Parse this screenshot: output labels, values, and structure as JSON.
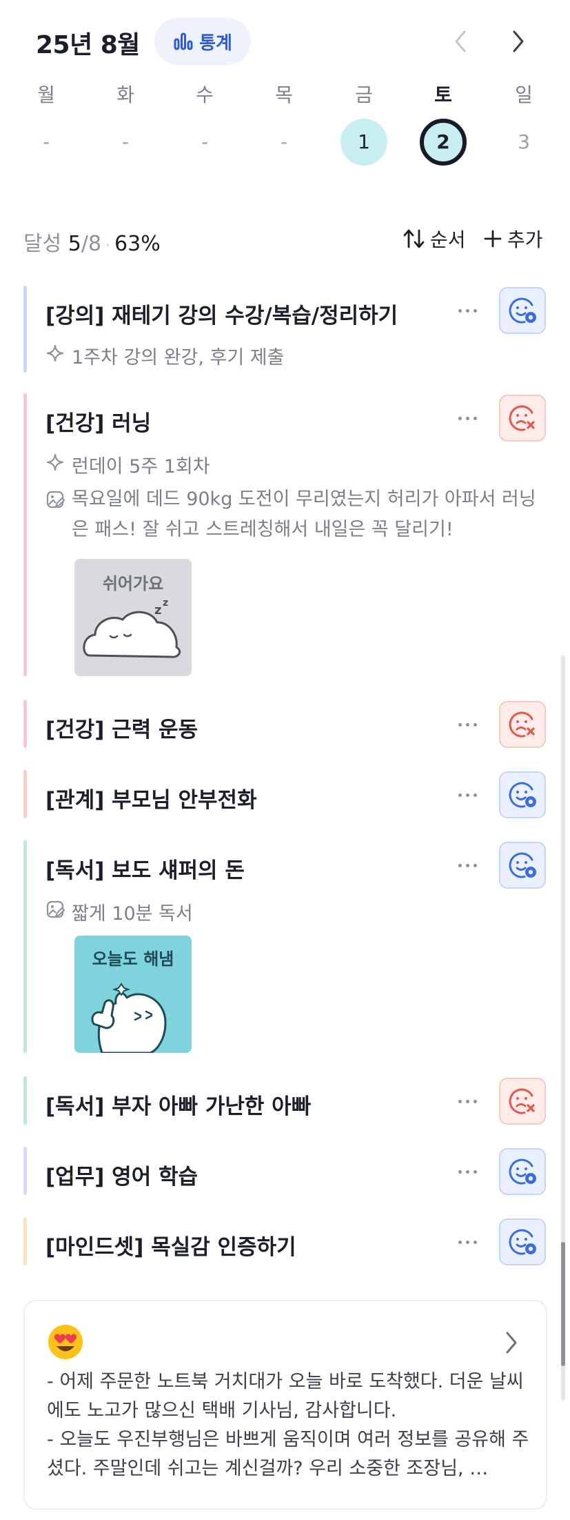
{
  "header": {
    "month_title": "25년 8월",
    "stats_label": "통계"
  },
  "week": {
    "days": [
      {
        "name": "월",
        "value": "-",
        "state": "none"
      },
      {
        "name": "화",
        "value": "-",
        "state": "none"
      },
      {
        "name": "수",
        "value": "-",
        "state": "none"
      },
      {
        "name": "목",
        "value": "-",
        "state": "none"
      },
      {
        "name": "금",
        "value": "1",
        "state": "done"
      },
      {
        "name": "토",
        "value": "2",
        "state": "today"
      },
      {
        "name": "일",
        "value": "3",
        "state": "none"
      }
    ]
  },
  "summary": {
    "label": "달성",
    "done": "5",
    "total": "/8",
    "percent": "63%",
    "order_label": "순서",
    "add_label": "추가"
  },
  "habits": [
    {
      "title": "[강의] 재테기 강의 수강/복습/정리하기",
      "goal": "1주차 강의 완강, 후기 제출",
      "status": "success",
      "bar_color": "#c9d6f6"
    },
    {
      "title": "[건강] 러닝",
      "goal": "런데이 5주 1회차",
      "memo": "목요일에 데드 90kg 도전이 무리였는지 허리가 아파서 러닝은 패스! 잘 쉬고 스트레칭해서 내일은 꼭 달리기!",
      "sticker_text": "쉬어가요",
      "status": "fail",
      "bar_color": "#f6c7dc"
    },
    {
      "title": "[건강] 근력 운동",
      "status": "fail",
      "bar_color": "#f6c7dc"
    },
    {
      "title": "[관계] 부모님 안부전화",
      "status": "success",
      "bar_color": "#f8cdc4"
    },
    {
      "title": "[독서] 보도 섀퍼의 돈",
      "memo": "짧게 10분 독서",
      "sticker_text": "오늘도 해냄",
      "status": "success",
      "bar_color": "#bfe9d3"
    },
    {
      "title": "[독서] 부자 아빠 가난한 아빠",
      "status": "fail",
      "bar_color": "#bfe9d3"
    },
    {
      "title": "[업무] 영어 학습",
      "status": "success",
      "bar_color": "#d6d8f6"
    },
    {
      "title": "[마인드셋] 목실감 인증하기",
      "status": "success",
      "bar_color": "#fbe1bf"
    }
  ],
  "diary": {
    "line1": "- 어제 주문한 노트북 거치대가 오늘 바로 도착했다. 더운 날씨에도 노고가 많으신 택배 기사님, 감사합니다.",
    "line2": "- 오늘도 우진부행님은 바쁘게 움직이며 여러 정보를 공유해 주셨다. 주말인데 쉬고는 계신걸까? 우리 소중한 조장님, …"
  },
  "colors": {
    "accent": "#2f5bd6",
    "success": "#3b6be0",
    "fail": "#e2584a",
    "today_ring": "#161b26",
    "done_fill": "#c8eef1"
  }
}
